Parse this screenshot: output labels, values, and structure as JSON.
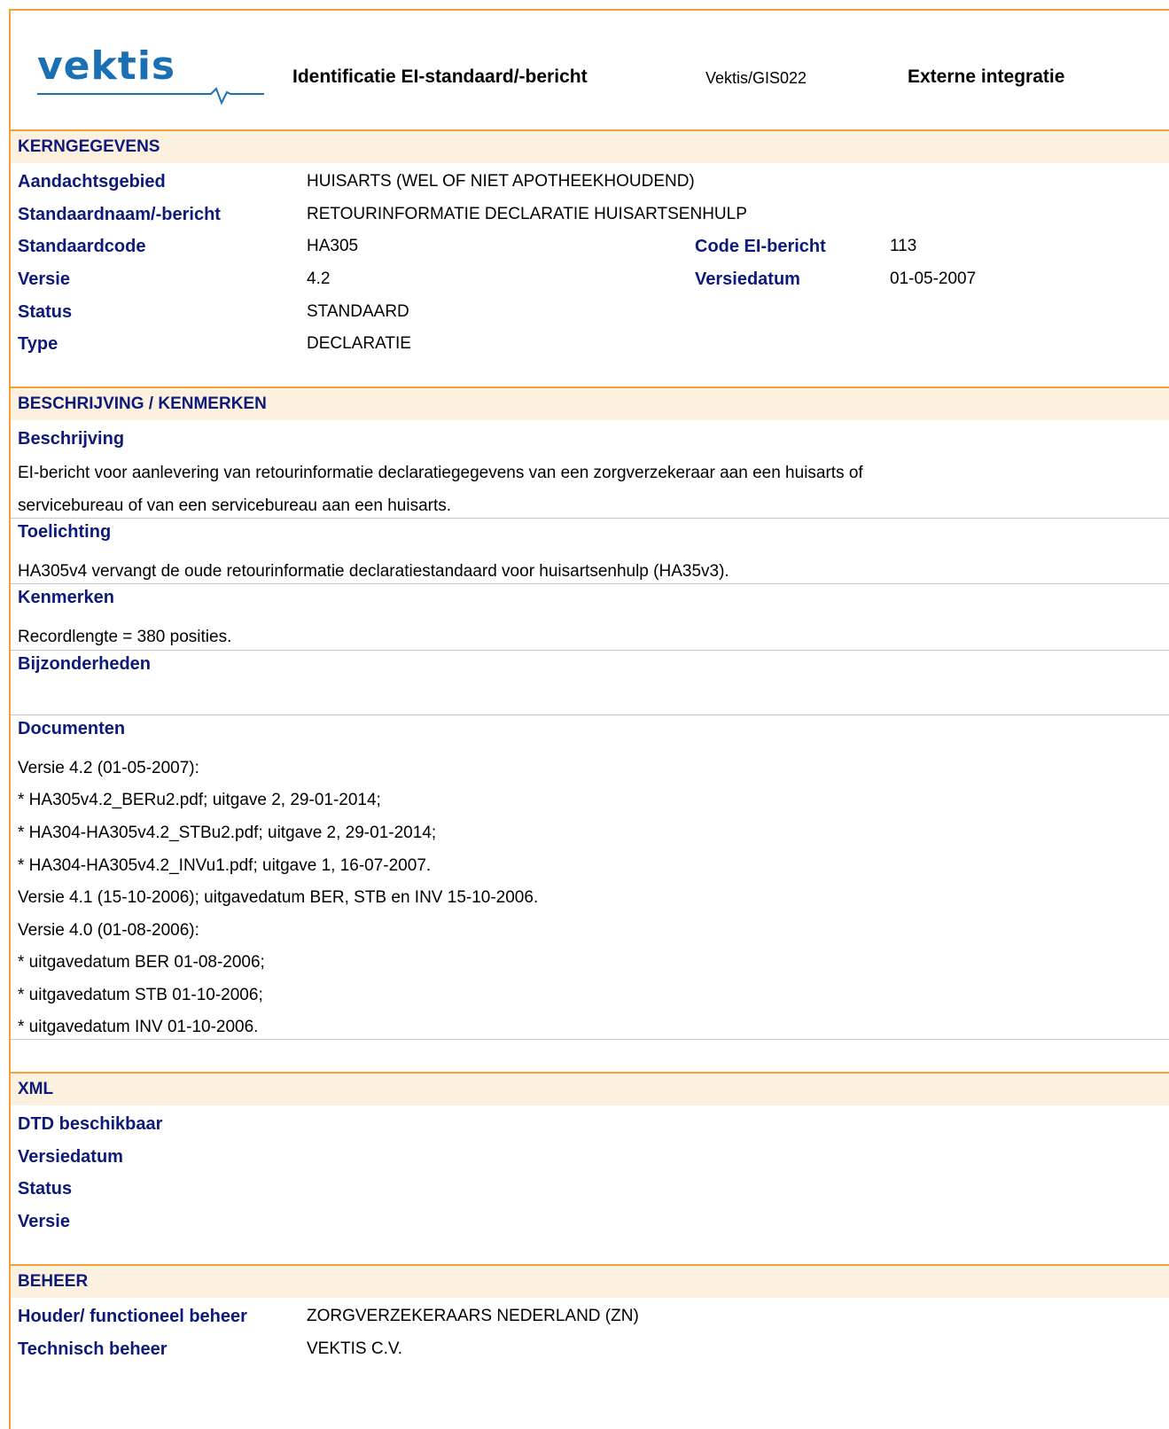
{
  "header": {
    "logo_text": "vektis",
    "title": "Identificatie EI-standaard/-bericht",
    "code": "Vektis/GIS022",
    "right_title": "Externe integratie"
  },
  "kerngegevens": {
    "heading": "KERNGEGEVENS",
    "aandachtsgebied_label": "Aandachtsgebied",
    "aandachtsgebied_value": "HUISARTS (WEL OF NIET APOTHEEKHOUDEND)",
    "standaardnaam_label": "Standaardnaam/-bericht",
    "standaardnaam_value": "RETOURINFORMATIE DECLARATIE HUISARTSENHULP",
    "standaardcode_label": "Standaardcode",
    "standaardcode_value": "HA305",
    "code_ei_label": "Code EI-bericht",
    "code_ei_value": "113",
    "versie_label": "Versie",
    "versie_value": "4.2",
    "versiedatum_label": "Versiedatum",
    "versiedatum_value": "01-05-2007",
    "status_label": "Status",
    "status_value": "STANDAARD",
    "type_label": "Type",
    "type_value": "DECLARATIE"
  },
  "beschrijving": {
    "heading": "BESCHRIJVING / KENMERKEN",
    "beschrijving_label": "Beschrijving",
    "beschrijving_lines": [
      "EI-bericht voor aanlevering van retourinformatie declaratiegegevens van een zorgverzekeraar aan een huisarts of",
      "servicebureau of van een servicebureau aan een huisarts."
    ],
    "toelichting_label": "Toelichting",
    "toelichting_text": "HA305v4 vervangt de oude retourinformatie declaratiestandaard voor huisartsenhulp (HA35v3).",
    "kenmerken_label": "Kenmerken",
    "kenmerken_text": "Recordlengte = 380 posities.",
    "bijzonderheden_label": "Bijzonderheden",
    "documenten_label": "Documenten",
    "documenten_lines": [
      "Versie 4.2 (01-05-2007):",
      "*  HA305v4.2_BERu2.pdf; uitgave 2, 29-01-2014;",
      "*  HA304-HA305v4.2_STBu2.pdf; uitgave 2, 29-01-2014;",
      "*  HA304-HA305v4.2_INVu1.pdf; uitgave 1, 16-07-2007.",
      "Versie 4.1 (15-10-2006); uitgavedatum BER, STB en INV 15-10-2006.",
      "Versie 4.0 (01-08-2006):",
      "* uitgavedatum BER 01-08-2006;",
      "* uitgavedatum STB 01-10-2006;",
      "* uitgavedatum INV 01-10-2006."
    ]
  },
  "xml": {
    "heading": "XML",
    "dtd_label": "DTD beschikbaar",
    "versiedatum_label": "Versiedatum",
    "status_label": "Status",
    "versie_label": "Versie"
  },
  "beheer": {
    "heading": "BEHEER",
    "houder_label": "Houder/ functioneel beheer",
    "houder_value": "ZORGVERZEKERAARS NEDERLAND (ZN)",
    "technisch_label": "Technisch beheer",
    "technisch_value": "VEKTIS C.V."
  }
}
